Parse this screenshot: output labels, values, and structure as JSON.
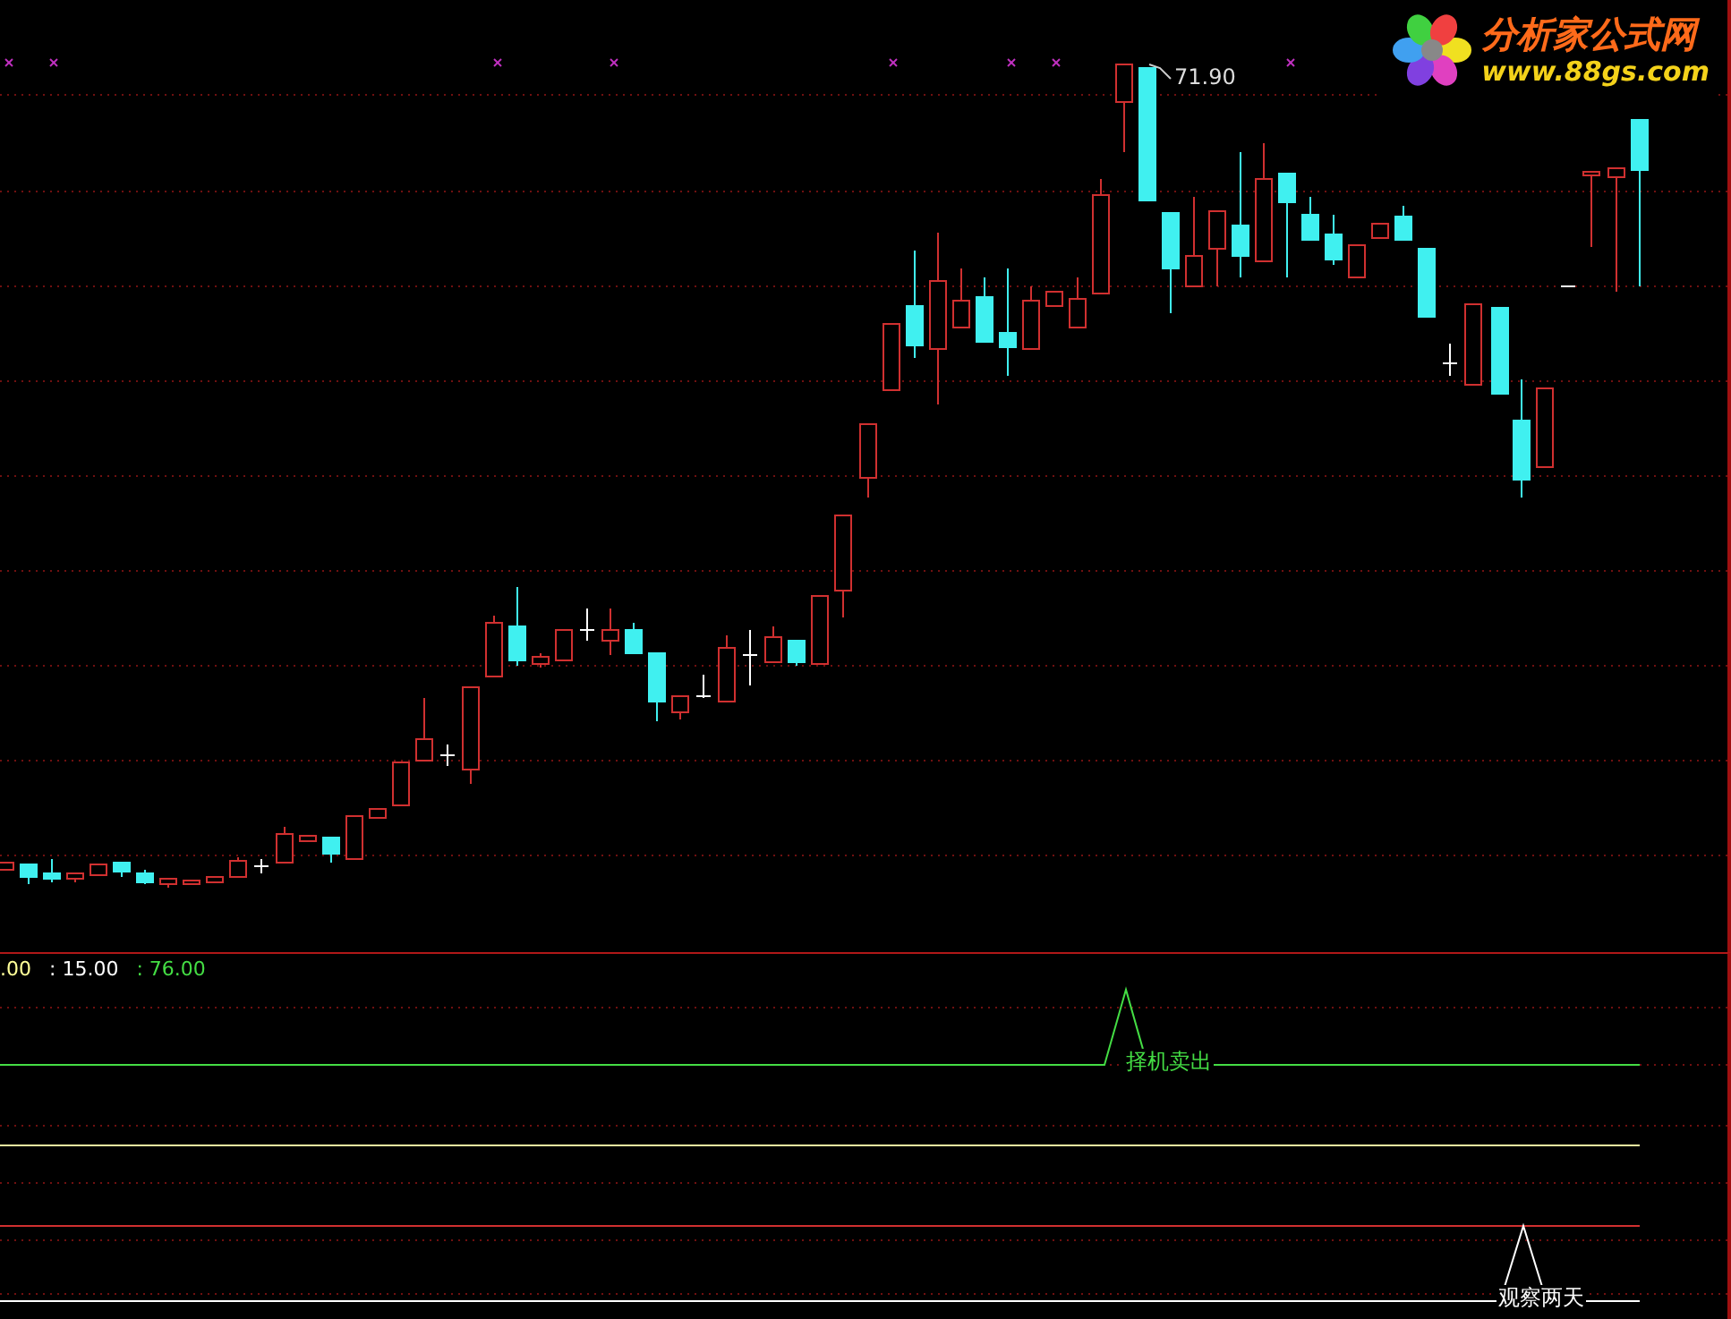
{
  "logo": {
    "title": "分析家公式网",
    "url": "www.88gs.com"
  },
  "price_chart": {
    "high_label": "71.90"
  },
  "indicator": {
    "values": [
      {
        "text": ".00",
        "color": "#ffff99"
      },
      {
        "text": ": 15.00",
        "color": "#ffffff"
      },
      {
        "text": ": 76.00",
        "color": "#44dd44"
      }
    ],
    "signals": [
      {
        "text": "择机卖出",
        "color": "#44dd44"
      },
      {
        "text": "观察两天",
        "color": "#ffffff"
      }
    ]
  }
}
